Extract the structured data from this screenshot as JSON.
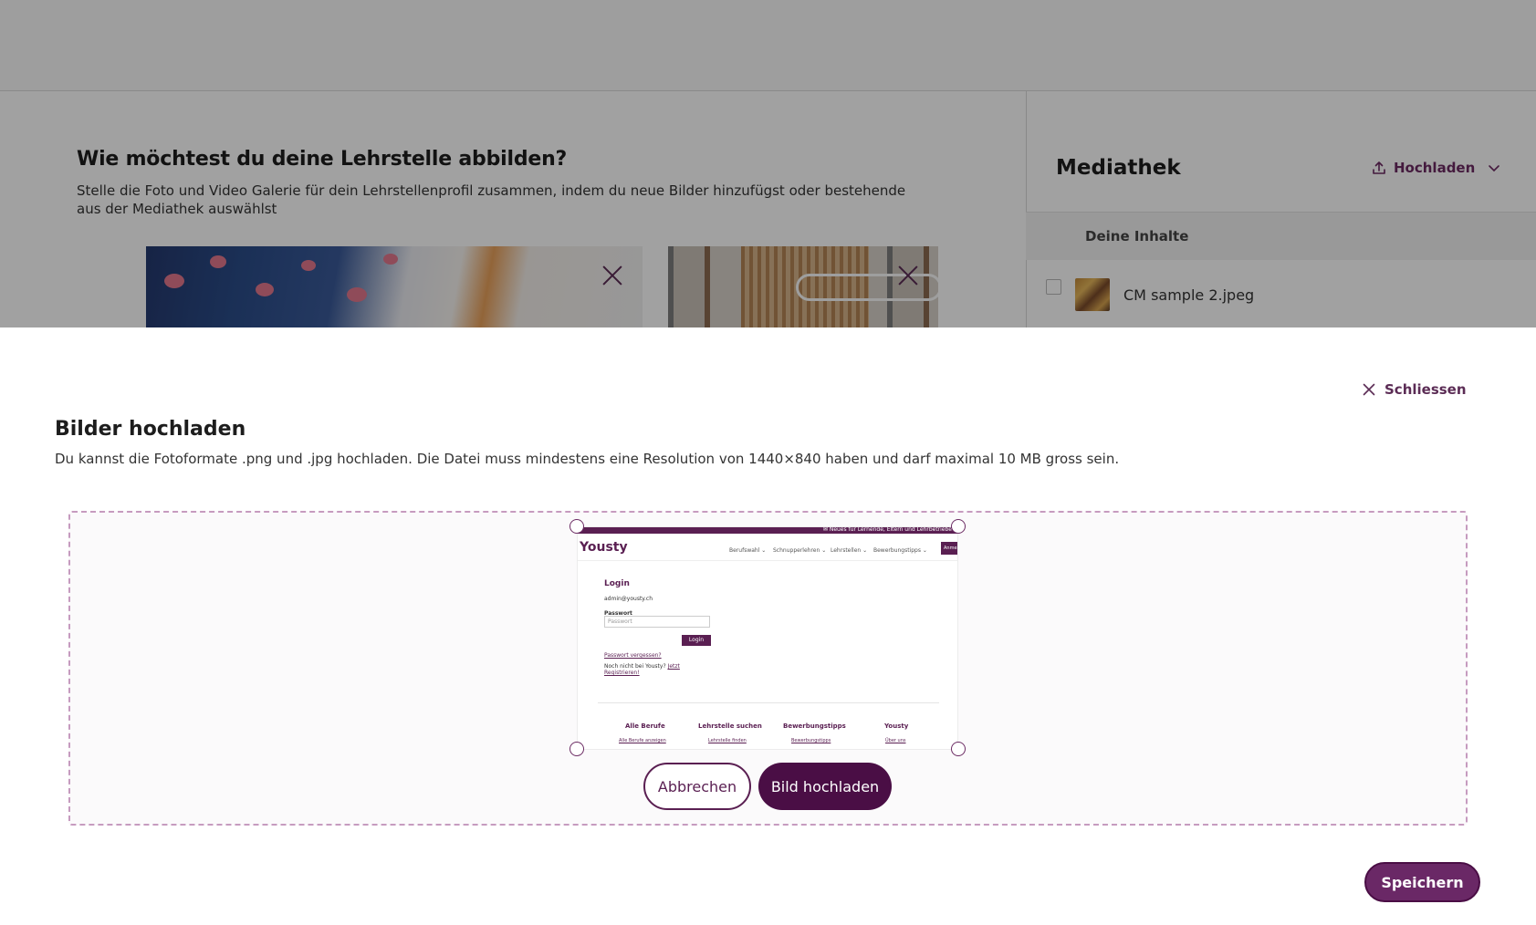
{
  "background_page": {
    "section_title": "Wie möchtest du deine Lehrstelle abbilden?",
    "section_description": "Stelle die Foto und Video Galerie für dein Lehrstellenprofil zusammen, indem du neue Bilder hinzufügst oder bestehende aus der Mediathek auswählst",
    "sidebar": {
      "title": "Mediathek",
      "upload_label": "Hochladen",
      "content_tab": "Deine Inhalte",
      "items": [
        {
          "filename": "CM sample 2.jpeg",
          "checked": false
        }
      ]
    }
  },
  "upload_panel": {
    "close_label": "Schliessen",
    "title": "Bilder hochladen",
    "description": "Du kannst die Fotoformate .png und .jpg hochladen. Die Datei muss mindestens eine Resolution von 1440×840 haben und darf maximal 10 MB gross sein.",
    "cancel_label": "Abbrechen",
    "upload_label": "Bild hochladen",
    "save_label": "Speichern"
  },
  "preview": {
    "topbar_text": "✉ Neues für Lernende, Eltern und Lehrbetriebe",
    "logo": "Yousty",
    "nav": [
      "Berufswahl ⌄",
      "Schnupperlehren ⌄",
      "Lehrstellen ⌄",
      "Bewerbungstipps ⌄"
    ],
    "cta": "Anmelden",
    "login_title": "Login",
    "email": "admin@yousty.ch",
    "password_label": "Passwort",
    "password_placeholder": "Passwort",
    "login_button": "Login",
    "forgot_link": "Passwort vergessen?",
    "register_text": "Noch nicht bei Yousty?",
    "register_link": "Jetzt Registrieren!",
    "footer_headings": [
      "Alle Berufe",
      "Lehrstelle suchen",
      "Bewerbungstipps",
      "Yousty"
    ],
    "footer_links": [
      "Alle Berufe anzeigen",
      "Lehrstelle finden",
      "Bewerbungstipps",
      "Über uns"
    ]
  },
  "colors": {
    "brand": "#5a1f52",
    "brand_dark": "#4a0e45",
    "dropzone_border": "#c69bbf"
  }
}
